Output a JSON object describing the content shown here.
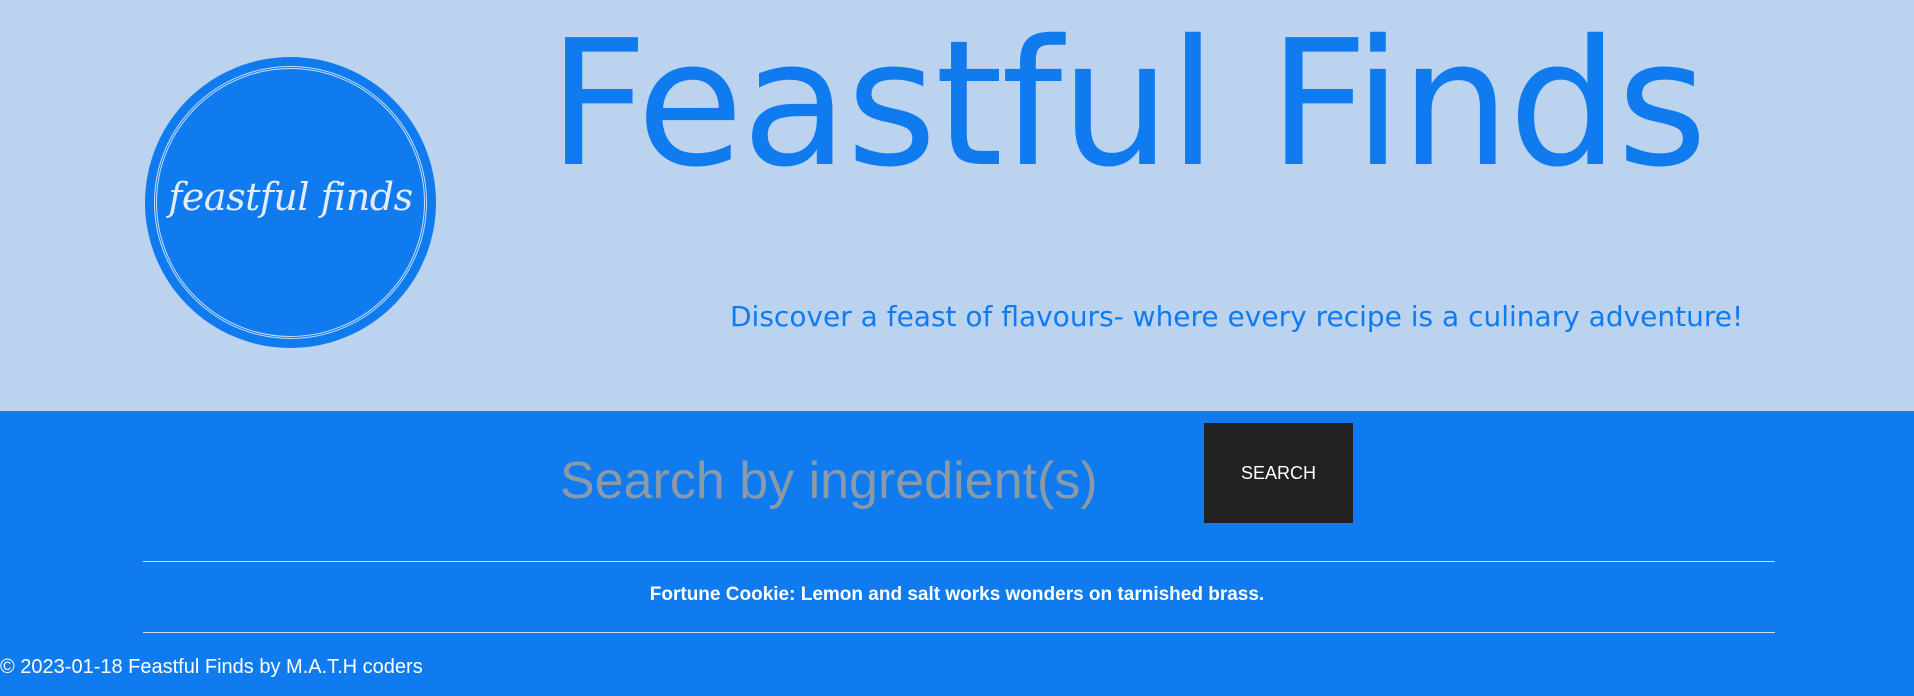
{
  "header": {
    "logo_text": "feastful finds",
    "title": "Feastful Finds",
    "tagline": "Discover a feast of flavours- where every recipe is a culinary adventure!"
  },
  "search": {
    "placeholder": "Search by ingredient(s)",
    "button_label": "SEARCH"
  },
  "fortune": {
    "text": "Fortune Cookie: Lemon and salt works wonders on tarnished brass."
  },
  "footer": {
    "text": "© 2023-01-18 Feastful Finds by M.A.T.H coders"
  },
  "colors": {
    "header_background": "#bcd3f0",
    "brand_blue": "#107bef",
    "button_background": "#222222"
  }
}
